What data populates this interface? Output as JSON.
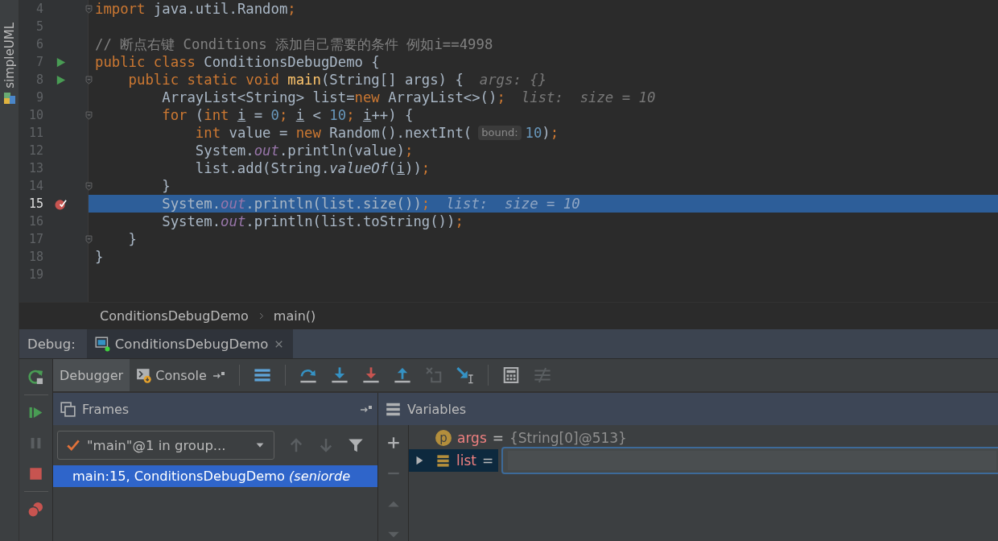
{
  "tool_strip": {
    "label": "simpleUML"
  },
  "editor": {
    "lines": [
      {
        "number": "4",
        "run_marker": false,
        "breakpoint": false,
        "fold": true,
        "current": false,
        "tokens": [
          {
            "kind": "kw",
            "text": "import"
          },
          {
            "kind": "plain",
            "text": " java.util.Random"
          },
          {
            "kind": "punct",
            "text": ";"
          }
        ]
      },
      {
        "number": "5",
        "run_marker": false,
        "breakpoint": false,
        "fold": false,
        "current": false
      },
      {
        "number": "6",
        "run_marker": false,
        "breakpoint": false,
        "fold": false,
        "current": false,
        "tokens": [
          {
            "kind": "comment",
            "text": "// 断点右键 Conditions 添加自己需要的条件 例如i==4998"
          }
        ]
      },
      {
        "number": "7",
        "run_marker": true,
        "breakpoint": false,
        "fold": false,
        "current": false,
        "tokens": [
          {
            "kind": "kw",
            "text": "public class "
          },
          {
            "kind": "plain",
            "text": "ConditionsDebugDemo {"
          }
        ]
      },
      {
        "number": "8",
        "run_marker": true,
        "breakpoint": false,
        "fold": true,
        "current": false,
        "tokens": [
          {
            "kind": "kw",
            "text": "    public static void "
          },
          {
            "kind": "decl",
            "text": "main"
          },
          {
            "kind": "plain",
            "text": "(String[] args) {"
          },
          {
            "kind": "hint",
            "text": "args: {}"
          }
        ]
      },
      {
        "number": "9",
        "run_marker": false,
        "breakpoint": false,
        "fold": false,
        "current": false,
        "tokens": [
          {
            "kind": "plain",
            "text": "        ArrayList<String> list="
          },
          {
            "kind": "kw",
            "text": "new"
          },
          {
            "kind": "plain",
            "text": " ArrayList<>()"
          },
          {
            "kind": "punct",
            "text": ";"
          },
          {
            "kind": "hint",
            "text": "list:  size = 10"
          }
        ]
      },
      {
        "number": "10",
        "run_marker": false,
        "breakpoint": false,
        "fold": true,
        "current": false,
        "tokens": [
          {
            "kind": "kw",
            "text": "        for"
          },
          {
            "kind": "plain",
            "text": " ("
          },
          {
            "kind": "kw",
            "text": "int "
          },
          {
            "kind": "var",
            "text": "i"
          },
          {
            "kind": "plain",
            "text": " = "
          },
          {
            "kind": "num",
            "text": "0"
          },
          {
            "kind": "punct",
            "text": "; "
          },
          {
            "kind": "var",
            "text": "i"
          },
          {
            "kind": "plain",
            "text": " < "
          },
          {
            "kind": "num",
            "text": "10"
          },
          {
            "kind": "punct",
            "text": "; "
          },
          {
            "kind": "var",
            "text": "i"
          },
          {
            "kind": "plain",
            "text": "++) {"
          }
        ]
      },
      {
        "number": "11",
        "run_marker": false,
        "breakpoint": false,
        "fold": false,
        "current": false,
        "tokens": [
          {
            "kind": "kw",
            "text": "            int"
          },
          {
            "kind": "plain",
            "text": " value = "
          },
          {
            "kind": "kw",
            "text": "new"
          },
          {
            "kind": "plain",
            "text": " Random().nextInt("
          },
          {
            "kind": "inlay",
            "text": "bound:"
          },
          {
            "kind": "num",
            "text": "10"
          },
          {
            "kind": "plain",
            "text": ")"
          },
          {
            "kind": "punct",
            "text": ";"
          }
        ]
      },
      {
        "number": "12",
        "run_marker": false,
        "breakpoint": false,
        "fold": false,
        "current": false,
        "tokens": [
          {
            "kind": "plain",
            "text": "            System."
          },
          {
            "kind": "field",
            "text": "out"
          },
          {
            "kind": "plain",
            "text": ".println(value)"
          },
          {
            "kind": "punct",
            "text": ";"
          }
        ]
      },
      {
        "number": "13",
        "run_marker": false,
        "breakpoint": false,
        "fold": false,
        "current": false,
        "tokens": [
          {
            "kind": "plain",
            "text": "            list.add(String."
          },
          {
            "kind": "static",
            "text": "valueOf"
          },
          {
            "kind": "plain",
            "text": "("
          },
          {
            "kind": "var",
            "text": "i"
          },
          {
            "kind": "plain",
            "text": "))"
          },
          {
            "kind": "punct",
            "text": ";"
          }
        ]
      },
      {
        "number": "14",
        "run_marker": false,
        "breakpoint": false,
        "fold": true,
        "current": false,
        "tokens": [
          {
            "kind": "plain",
            "text": "        }"
          }
        ]
      },
      {
        "number": "15",
        "run_marker": false,
        "breakpoint": true,
        "fold": false,
        "current": true,
        "tokens": [
          {
            "kind": "plain",
            "text": "        System."
          },
          {
            "kind": "field",
            "text": "out"
          },
          {
            "kind": "plain",
            "text": ".println(list.size())"
          },
          {
            "kind": "punct",
            "text": ";"
          },
          {
            "kind": "hint",
            "text": "list:  size = 10"
          }
        ]
      },
      {
        "number": "16",
        "run_marker": false,
        "breakpoint": false,
        "fold": false,
        "current": false,
        "tokens": [
          {
            "kind": "plain",
            "text": "        System."
          },
          {
            "kind": "field",
            "text": "out"
          },
          {
            "kind": "plain",
            "text": ".println(list.toString())"
          },
          {
            "kind": "punct",
            "text": ";"
          }
        ]
      },
      {
        "number": "17",
        "run_marker": false,
        "breakpoint": false,
        "fold": true,
        "current": false,
        "tokens": [
          {
            "kind": "plain",
            "text": "    }"
          }
        ]
      },
      {
        "number": "18",
        "run_marker": false,
        "breakpoint": false,
        "fold": false,
        "current": false,
        "tokens": [
          {
            "kind": "plain",
            "text": "}"
          }
        ]
      },
      {
        "number": "19",
        "run_marker": false,
        "breakpoint": false,
        "fold": false,
        "current": false
      }
    ]
  },
  "breadcrumbs": [
    "ConditionsDebugDemo",
    "main()"
  ],
  "debug": {
    "label": "Debug:",
    "tabs": [
      {
        "label": "ConditionsDebugDemo",
        "selected": true
      }
    ],
    "side_actions": [
      [
        {
          "kind": "rerun",
          "disabled": false
        }
      ],
      [
        {
          "kind": "resume",
          "disabled": false
        },
        {
          "kind": "pause",
          "disabled": true
        },
        {
          "kind": "stop",
          "disabled": false
        }
      ],
      [
        {
          "kind": "breakpoints",
          "disabled": false
        }
      ]
    ],
    "view_tabs": [
      {
        "label": "Debugger",
        "selected": true
      },
      {
        "label": "Console",
        "selected": false
      }
    ],
    "action_groups": [
      [
        {
          "kind": "execution-point",
          "disabled": false
        }
      ],
      [
        {
          "kind": "step-over",
          "disabled": false
        },
        {
          "kind": "step-into",
          "disabled": false
        },
        {
          "kind": "force-step-into",
          "disabled": false
        },
        {
          "kind": "step-out",
          "disabled": false
        },
        {
          "kind": "drop-frame",
          "disabled": true
        },
        {
          "kind": "run-to-cursor",
          "disabled": false
        }
      ],
      [
        {
          "kind": "evaluate",
          "disabled": false
        },
        {
          "kind": "trace",
          "disabled": true
        }
      ]
    ],
    "frames": {
      "title": "Frames",
      "thread": "\"main\"@1 in group...",
      "actions": [
        {
          "kind": "up",
          "disabled": true
        },
        {
          "kind": "down",
          "disabled": true
        },
        {
          "kind": "filter",
          "disabled": false
        }
      ],
      "items": [
        {
          "text": "main:15, ConditionsDebugDemo *(seniorde*",
          "selected": true
        }
      ]
    },
    "variables": {
      "title": "Variables",
      "actions": [
        {
          "kind": "add",
          "disabled": false
        },
        {
          "kind": "remove",
          "disabled": true
        },
        {
          "kind": "move-up",
          "disabled": true
        },
        {
          "kind": "move-down",
          "disabled": true
        }
      ],
      "items": [
        {
          "kind": "param",
          "badge": "p",
          "name": "args",
          "operator": "=",
          "value": "{String[0]@513}",
          "expandable": false,
          "selected": false,
          "editing": false
        },
        {
          "kind": "field",
          "name": "list",
          "operator": "=",
          "expandable": true,
          "selected": true,
          "editing": true
        }
      ]
    }
  }
}
